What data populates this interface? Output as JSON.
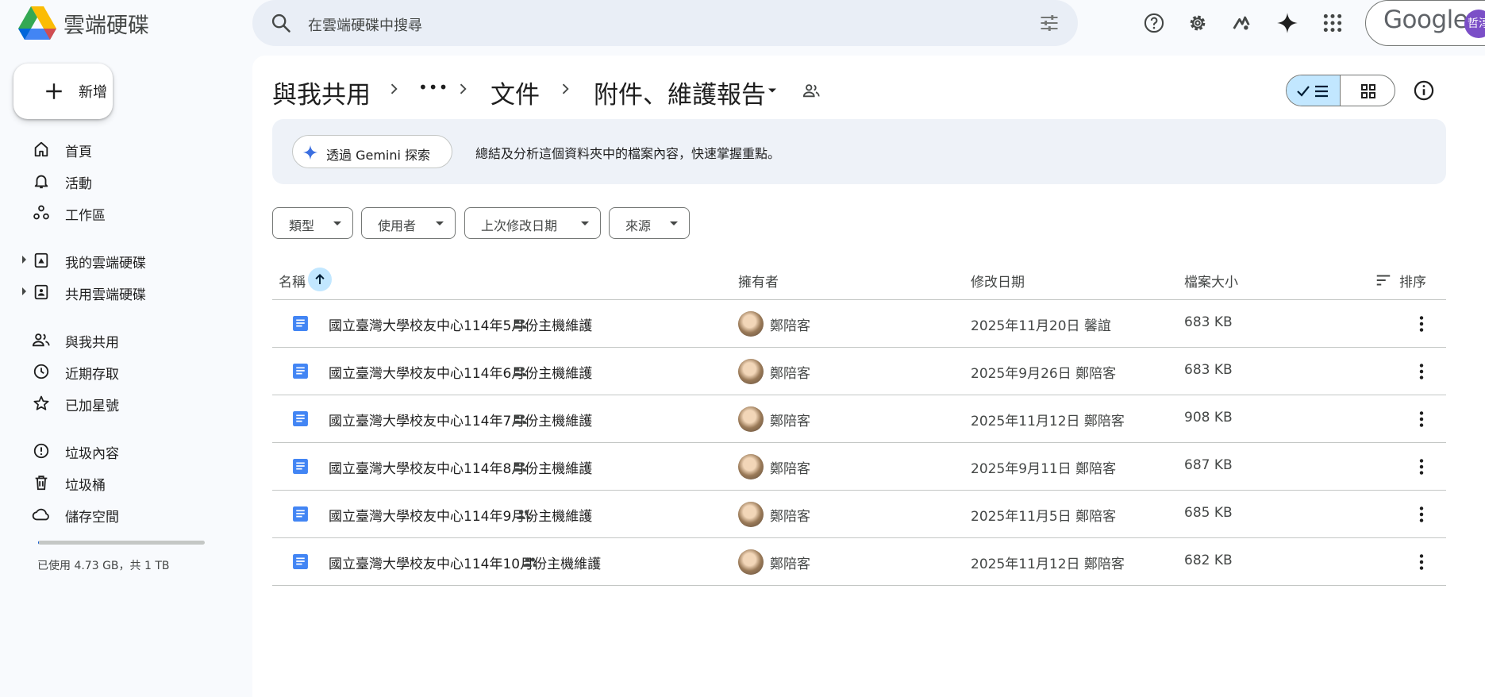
{
  "app": {
    "title": "雲端硬碟"
  },
  "search": {
    "placeholder": "在雲端硬碟中搜尋"
  },
  "account": {
    "brand": "Google",
    "avatar_text": "哲淳"
  },
  "toolbar_icons": [
    "help-icon",
    "settings-icon",
    "gemini-apps-icon",
    "gemini-icon",
    "apps-grid-icon"
  ],
  "sidebar": {
    "new_label": "新增",
    "items": [
      {
        "label": "首頁",
        "icon": "home-icon"
      },
      {
        "label": "活動",
        "icon": "bell-icon"
      },
      {
        "label": "工作區",
        "icon": "workspaces-icon"
      },
      {
        "label": "我的雲端硬碟",
        "icon": "my-drive-icon"
      },
      {
        "label": "共用雲端硬碟",
        "icon": "shared-drives-icon"
      },
      {
        "label": "與我共用",
        "icon": "people-icon"
      },
      {
        "label": "近期存取",
        "icon": "clock-icon"
      },
      {
        "label": "已加星號",
        "icon": "star-icon"
      },
      {
        "label": "垃圾內容",
        "icon": "spam-icon"
      },
      {
        "label": "垃圾桶",
        "icon": "trash-icon"
      },
      {
        "label": "儲存空間",
        "icon": "cloud-icon"
      }
    ],
    "storage": {
      "text": "已使用 4.73 GB，共 1 TB",
      "used_fraction": 0.0046
    }
  },
  "breadcrumb": {
    "root": "與我共用",
    "ellipsis": "•••",
    "parent": "文件",
    "current": "附件、維護報告"
  },
  "gemini": {
    "button_label": "透過 Gemini 探索",
    "description": "總結及分析這個資料夾中的檔案內容，快速掌握重點。"
  },
  "filters": [
    "類型",
    "使用者",
    "上次修改日期",
    "來源"
  ],
  "table": {
    "headers": {
      "name": "名稱",
      "owner": "擁有者",
      "modified": "修改日期",
      "size": "檔案大小",
      "sort": "排序"
    },
    "rows": [
      {
        "name": "國立臺灣大學校友中心114年5月份主機維護",
        "owner": "鄭陪客",
        "modified": "2025年11月20日 馨誼",
        "size": "683 KB"
      },
      {
        "name": "國立臺灣大學校友中心114年6月份主機維護",
        "owner": "鄭陪客",
        "modified": "2025年9月26日 鄭陪客",
        "size": "683 KB"
      },
      {
        "name": "國立臺灣大學校友中心114年7月份主機維護",
        "owner": "鄭陪客",
        "modified": "2025年11月12日 鄭陪客",
        "size": "908 KB"
      },
      {
        "name": "國立臺灣大學校友中心114年8月份主機維護",
        "owner": "鄭陪客",
        "modified": "2025年9月11日 鄭陪客",
        "size": "687 KB"
      },
      {
        "name": "國立臺灣大學校友中心114年9月份主機維護",
        "owner": "鄭陪客",
        "modified": "2025年11月5日 鄭陪客",
        "size": "685 KB"
      },
      {
        "name": "國立臺灣大學校友中心114年10月份主機維護",
        "owner": "鄭陪客",
        "modified": "2025年11月12日 鄭陪客",
        "size": "682 KB"
      }
    ]
  }
}
